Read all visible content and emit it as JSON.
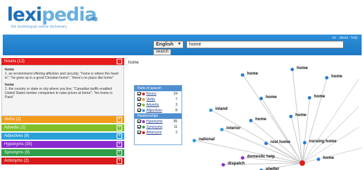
{
  "logo": {
    "word_a": "lexi",
    "word_b": "pedia",
    "tld": ".org",
    "tagline": "the multilingual online dictionary"
  },
  "search": {
    "language": "English",
    "query": "home",
    "button_label": "search",
    "header_links": "en  ·  about  ·  help"
  },
  "sidebar": {
    "noun_label": "Nouns (12)",
    "definitions": [
      {
        "head": "home",
        "text": "1. an environment offering affection and security; \"home is where the heart is\"; \"he grew up in a good Christian home\"; \"there's no place like home\""
      },
      {
        "head": "home",
        "text": "2. the country or state or city where you live; \"Canadian tariffs enabled United States lumber companies to raise prices at home\"; \"his home is Paris\""
      }
    ],
    "categories": [
      {
        "label": "Verbs (2)",
        "color": "#f39a1c"
      },
      {
        "label": "Adverbs (2)",
        "color": "#7fbf2a"
      },
      {
        "label": "Adjectives (8)",
        "color": "#2aa0d8"
      },
      {
        "label": "Hyponyms (35)",
        "color": "#8a2bd0"
      },
      {
        "label": "Synonyms (9)",
        "color": "#2f9e48"
      },
      {
        "label": "Antonyms (2)",
        "color": "#d81a1a"
      }
    ],
    "noun_color": "#e61b1b"
  },
  "graph": {
    "word": "home",
    "nodes": [
      {
        "label": "home",
        "color": "#2a7ad8"
      },
      {
        "label": "home",
        "color": "#2a7ad8"
      },
      {
        "label": "home",
        "color": "#2a7ad8"
      },
      {
        "label": "home",
        "color": "#2a7ad8"
      },
      {
        "label": "home",
        "color": "#2a7ad8"
      },
      {
        "label": "home",
        "color": "#2a7ad8"
      },
      {
        "label": "inland",
        "color": "#2aa0d8"
      },
      {
        "label": "home",
        "color": "#2a7ad8"
      },
      {
        "label": "interior",
        "color": "#2aa0d8"
      },
      {
        "label": "national",
        "color": "#2aa0d8"
      },
      {
        "label": "rest home",
        "color": "#2a7ad8"
      },
      {
        "label": "nursing home",
        "color": "#2a7ad8"
      },
      {
        "label": "home",
        "color": "#2a7ad8"
      },
      {
        "label": "domestic help",
        "color": "#8a2bd0"
      },
      {
        "label": "dispatch",
        "color": "#8a2bd0"
      },
      {
        "label": "shelter",
        "color": "#2a7ad8"
      }
    ]
  },
  "legend": {
    "title": "Parts of speech",
    "relations_title": "Relationships",
    "parts": [
      {
        "label": "Nouns",
        "count": "24",
        "color": "#e61b1b"
      },
      {
        "label": "Verbs",
        "count": "7",
        "color": "#f39a1c"
      },
      {
        "label": "Adverbs",
        "count": "3",
        "color": "#7fbf2a"
      },
      {
        "label": "Adjectives",
        "count": "8",
        "color": "#2aa0d8"
      }
    ],
    "relations": [
      {
        "label": "Hyponyms",
        "count": "55",
        "color": "#8a2bd0"
      },
      {
        "label": "Synonyms",
        "count": "11",
        "color": "#2f9e48"
      },
      {
        "label": "Antonyms",
        "count": "2",
        "color": "#d81a1a"
      }
    ]
  }
}
